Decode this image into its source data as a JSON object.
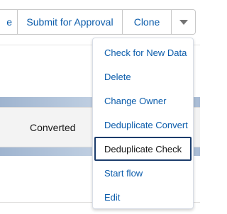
{
  "toolbar": {
    "edit_partial_label": "e",
    "submit_label": "Submit for Approval",
    "clone_label": "Clone"
  },
  "record": {
    "status_label": "Converted"
  },
  "menu": {
    "items": [
      {
        "label": "Check for New Data"
      },
      {
        "label": "Delete"
      },
      {
        "label": "Change Owner"
      },
      {
        "label": "Deduplicate Convert"
      },
      {
        "label": "Deduplicate Check",
        "focused": true
      },
      {
        "label": "Start flow"
      },
      {
        "label": "Edit"
      }
    ]
  },
  "icons": {
    "more_actions": "chevron-down-icon"
  },
  "colors": {
    "link": "#0b5cab",
    "focus_border": "#1b3c6b",
    "band": "#b7c8dd"
  }
}
